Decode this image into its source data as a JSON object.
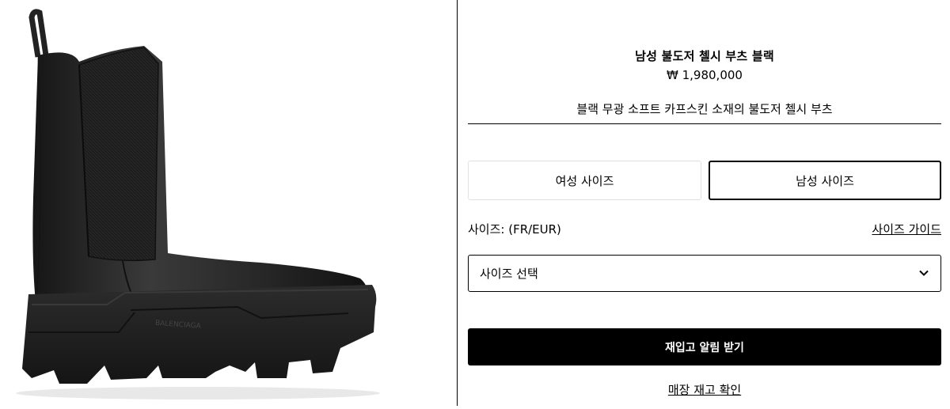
{
  "product": {
    "title": "남성 불도저 첼시 부츠 블랙",
    "price": "₩ 1,980,000",
    "description": "블랙 무광 소프트 카프스킨 소재의 불도저 첼시 부츠",
    "image_logo_text": "BALENCIAGA"
  },
  "size_tabs": {
    "women": "여성 사이즈",
    "men": "남성 사이즈",
    "selected": "men"
  },
  "size": {
    "label": "사이즈: (FR/EUR)",
    "guide_link": "사이즈 가이드",
    "select_value": "사이즈 선택"
  },
  "actions": {
    "notify": "재입고 알림 받기",
    "store_stock": "매장 재고 확인"
  },
  "icons": {
    "select_chevron": "chevron-down-icon"
  },
  "colors": {
    "primary": "#000000",
    "boot": "#2a2a2a",
    "tab_border": "#e1e1e1"
  }
}
